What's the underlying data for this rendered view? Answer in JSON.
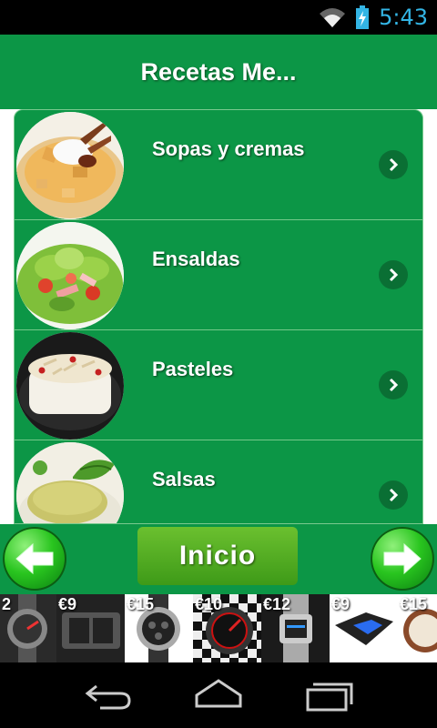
{
  "status_bar": {
    "time": "5:43"
  },
  "header": {
    "title": "Recetas Me..."
  },
  "list": {
    "items": [
      {
        "label": "Sopas y cremas",
        "image": "soup-photo"
      },
      {
        "label": "Ensaldas",
        "image": "salad-photo"
      },
      {
        "label": "Pasteles",
        "image": "cake-photo"
      },
      {
        "label": "Salsas",
        "image": "sauce-photo"
      }
    ]
  },
  "bottom_bar": {
    "home_label": "Inicio",
    "back_icon": "arrow-left-icon",
    "forward_icon": "arrow-right-icon"
  },
  "ad_banner": {
    "prices": [
      "2",
      "€9",
      "€15",
      "€10",
      "€12",
      "€9",
      "€15"
    ]
  },
  "colors": {
    "brand_green": "#0c9646",
    "dark_green": "#0a6f34",
    "status_blue": "#33b5e5"
  }
}
